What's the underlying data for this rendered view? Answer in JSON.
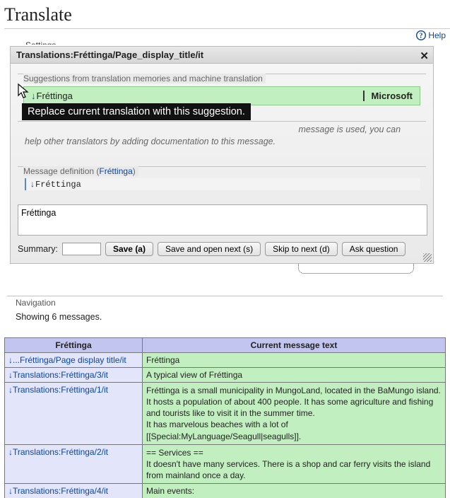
{
  "page_title": "Translate",
  "help_label": "Help",
  "settings_fragment": "Settings",
  "dialog": {
    "title": "Translations:Fréttinga/Page_display_title/it",
    "suggestion_legend": "Suggestions from translation memories and machine translation",
    "suggestion_text": "Fréttinga",
    "suggestion_provider": "Microsoft",
    "info_line1": "message is used, you can help other",
    "info_line2": "translators by adding documentation to this message.",
    "def_legend_prefix": "Message definition (",
    "def_legend_link": "Fréttinga",
    "def_legend_suffix": ")",
    "def_text": "Fréttinga",
    "textarea_value": "Fréttinga",
    "summary_label": "Summary:",
    "save": "Save (a)",
    "save_next": "Save and open next (s)",
    "skip": "Skip to next (d)",
    "ask": "Ask question"
  },
  "tooltip": "Replace current translation with this suggestion.",
  "nav": {
    "legend": "Navigation",
    "showing": "Showing 6 messages."
  },
  "table": {
    "col1": "Fréttinga",
    "col2": "Current message text",
    "rows": [
      {
        "link": "...Fréttinga/Page display title/it",
        "text": [
          "Fréttinga"
        ]
      },
      {
        "link": "Translations:Fréttinga/3/it",
        "text": [
          "A typical view of Fréttinga"
        ]
      },
      {
        "link": "Translations:Fréttinga/1/it",
        "text": [
          "Fréttinga is a small municipality in MungoLand, located in the BaMungo island.",
          "It hosts a population of about 400 people.  It has some agriculture and fishing and tourists like to visit it in the summer time.",
          "It has marvelous beaches with a lot of [[Special:MyLanguage/Seagull|seagulls]]."
        ]
      },
      {
        "link": "Translations:Fréttinga/2/it",
        "text": [
          "== Services ==",
          "It doesn't have many services. There is a shop and car ferry visits the island from mainland once a day."
        ]
      },
      {
        "link": "Translations:Fréttinga/4/it",
        "text": [
          "Main events:"
        ]
      }
    ]
  }
}
